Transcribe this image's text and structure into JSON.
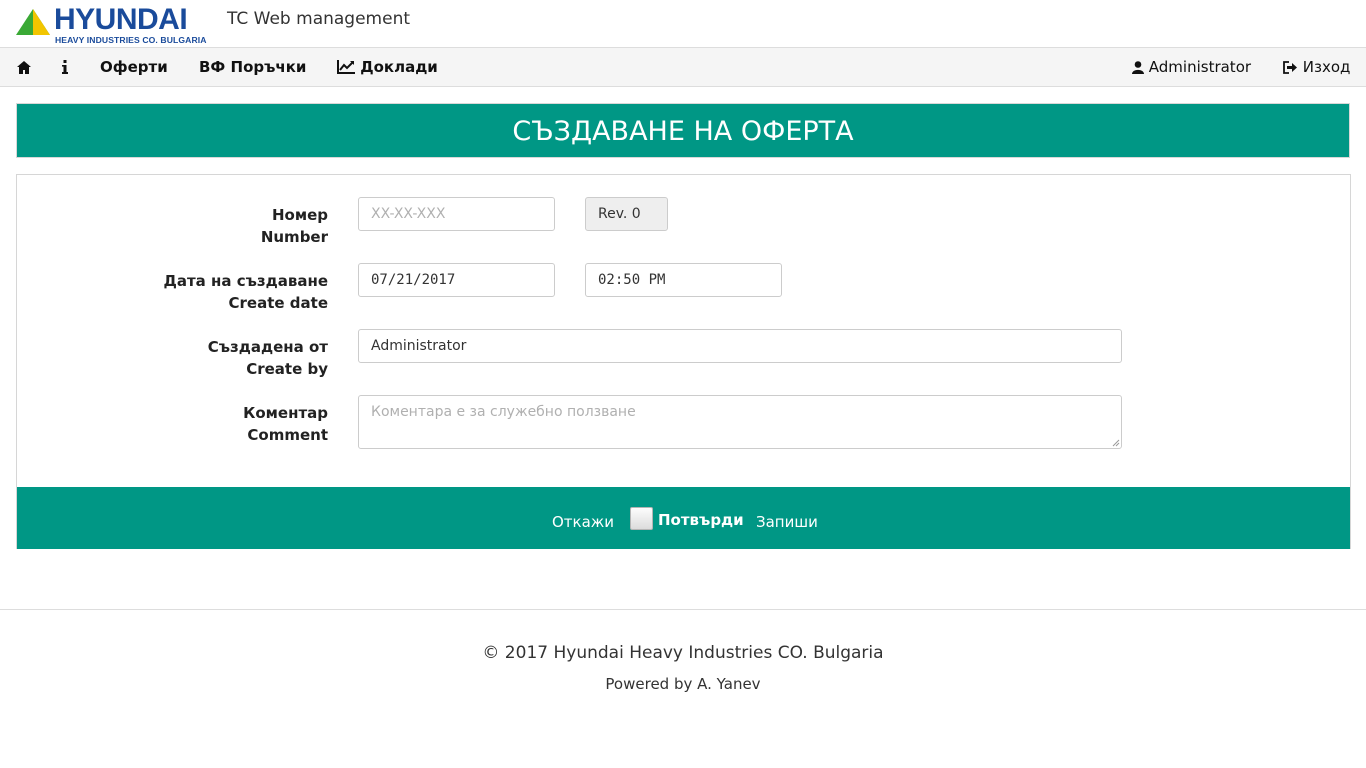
{
  "header": {
    "logo_word": "HYUNDAI",
    "logo_sub": "HEAVY INDUSTRIES CO. BULGARIA",
    "app_title": "TC Web management"
  },
  "nav": {
    "items": [
      {
        "label": "Оферти"
      },
      {
        "label": "ВФ Поръчки"
      },
      {
        "label": "Доклади"
      }
    ],
    "user_label": "Administrator",
    "logout_label": "Изход",
    "icons": [
      "home-icon",
      "info-icon",
      "chart-line-icon",
      "user-icon",
      "sign-out-icon"
    ]
  },
  "banner": {
    "title": "СЪЗДАВАНЕ НА ОФЕРТА"
  },
  "form": {
    "number": {
      "label_bg": "Номер",
      "label_en": "Number",
      "placeholder": "XX-XX-XXX",
      "revision": "Rev. 0"
    },
    "create_date": {
      "label_bg": "Дата на създаване",
      "label_en": "Create date",
      "date": "07/21/2017",
      "time": "02:50 PM"
    },
    "created_by": {
      "label_bg": "Създадена от",
      "label_en": "Create by",
      "value": "Administrator"
    },
    "comment": {
      "label_bg": "Коментар",
      "label_en": "Comment",
      "placeholder": "Коментара е за служебно ползване"
    }
  },
  "actions": {
    "cancel_label": "Откажи",
    "confirm_label": "Потвърди",
    "confirm_checked": false,
    "save_label": "Запиши"
  },
  "footer": {
    "copyright": "© 2017 Hyundai Heavy Industries CO. Bulgaria",
    "powered": "Powered by A. Yanev"
  },
  "colors": {
    "brand_blue": "#1a4b9b",
    "logo_green": "#3aa935",
    "logo_yellow": "#f2c500",
    "accent_teal": "#009785",
    "navbar_bg": "#f5f5f5"
  }
}
